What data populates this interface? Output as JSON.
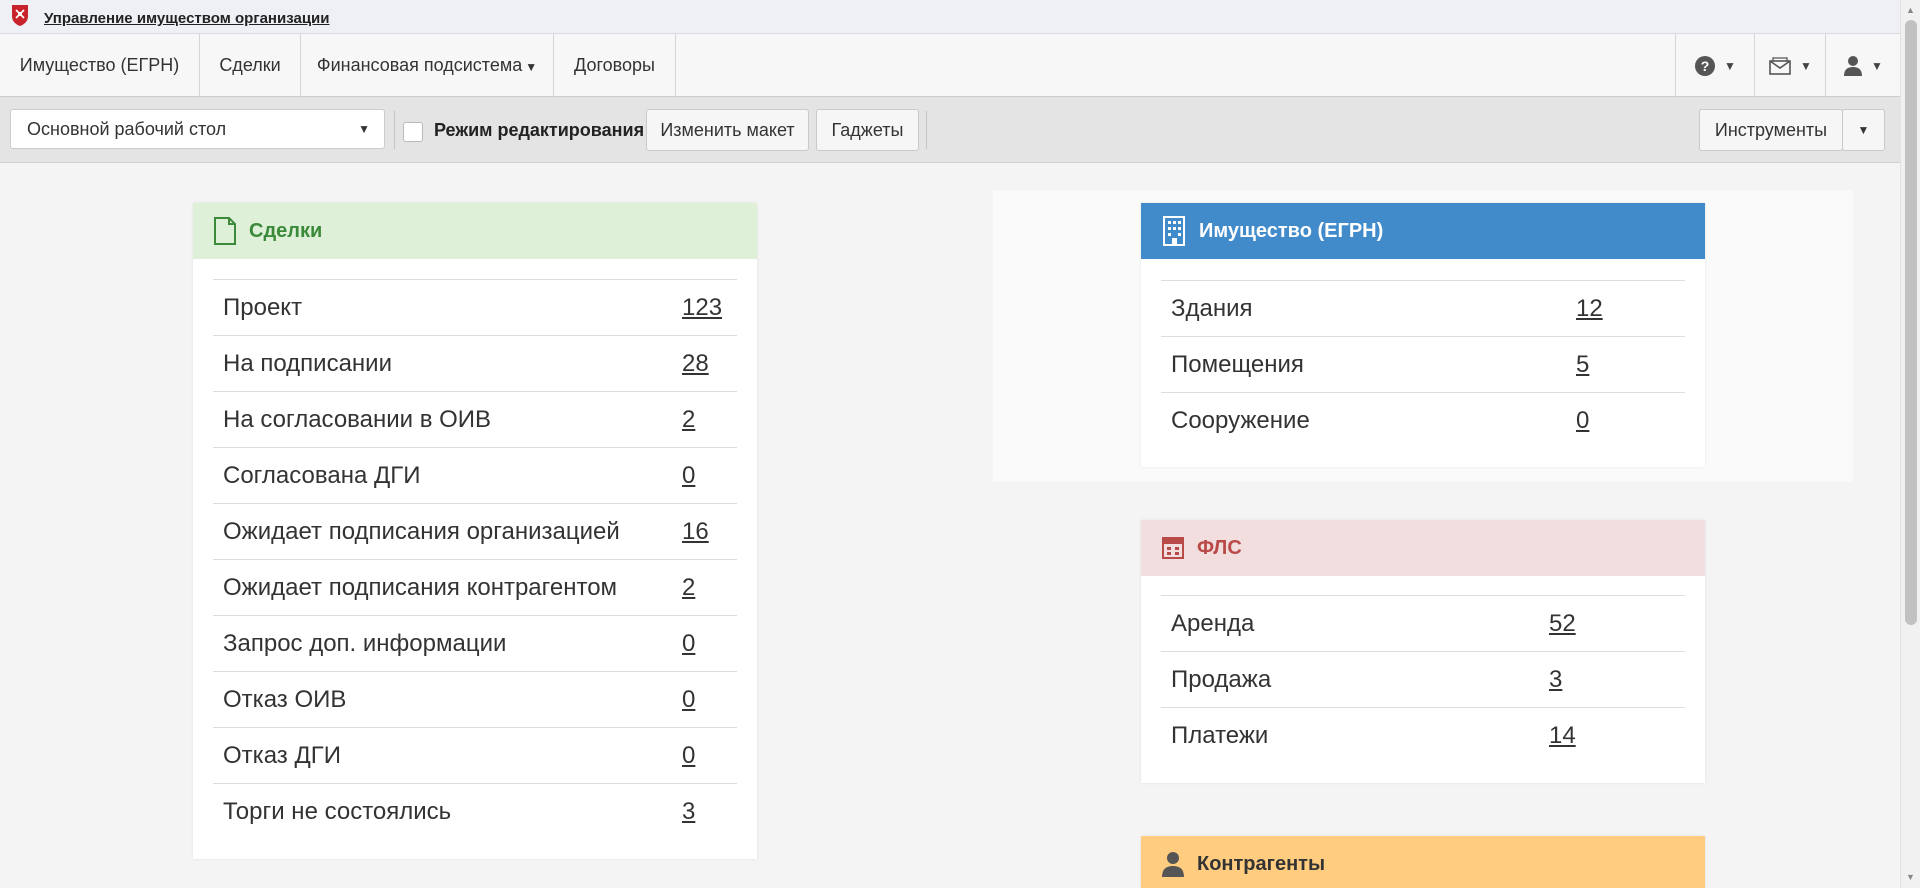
{
  "app": {
    "title": "Управление имуществом организации"
  },
  "nav": {
    "items": [
      "Имущество (ЕГРН)",
      "Сделки",
      "Финансовая подсистема",
      "Договоры"
    ]
  },
  "toolbar": {
    "desktop_select": "Основной рабочий стол",
    "edit_mode_label": "Режим редактирования",
    "change_layout": "Изменить макет",
    "gadgets": "Гаджеты",
    "tools": "Инструменты"
  },
  "gadgets": {
    "deals": {
      "title": "Сделки",
      "color": "#3a8a3a",
      "header_bg": "#dff0d8",
      "rows": [
        {
          "label": "Проект",
          "value": "123"
        },
        {
          "label": "На подписании",
          "value": "28"
        },
        {
          "label": "На согласовании в ОИВ",
          "value": "2"
        },
        {
          "label": "Согласована ДГИ",
          "value": "0"
        },
        {
          "label": "Ожидает подписания организацией",
          "value": "16"
        },
        {
          "label": "Ожидает подписания контрагентом",
          "value": "2"
        },
        {
          "label": "Запрос доп. информации",
          "value": "0"
        },
        {
          "label": "Отказ ОИВ",
          "value": "0"
        },
        {
          "label": "Отказ ДГИ",
          "value": "0"
        },
        {
          "label": "Торги не состоялись",
          "value": "3"
        }
      ]
    },
    "property": {
      "title": "Имущество (ЕГРН)",
      "header_bg": "#428bca",
      "rows": [
        {
          "label": "Здания",
          "value": "12"
        },
        {
          "label": "Помещения",
          "value": "5"
        },
        {
          "label": "Сооружение",
          "value": "0"
        }
      ]
    },
    "fls": {
      "title": "ФЛС",
      "color": "#b94a48",
      "header_bg": "#f2dede",
      "rows": [
        {
          "label": "Аренда",
          "value": "52"
        },
        {
          "label": "Продажа",
          "value": "3"
        },
        {
          "label": "Платежи",
          "value": "14"
        }
      ]
    },
    "contractors": {
      "title": "Контрагенты",
      "header_bg": "#ffcc80"
    }
  }
}
